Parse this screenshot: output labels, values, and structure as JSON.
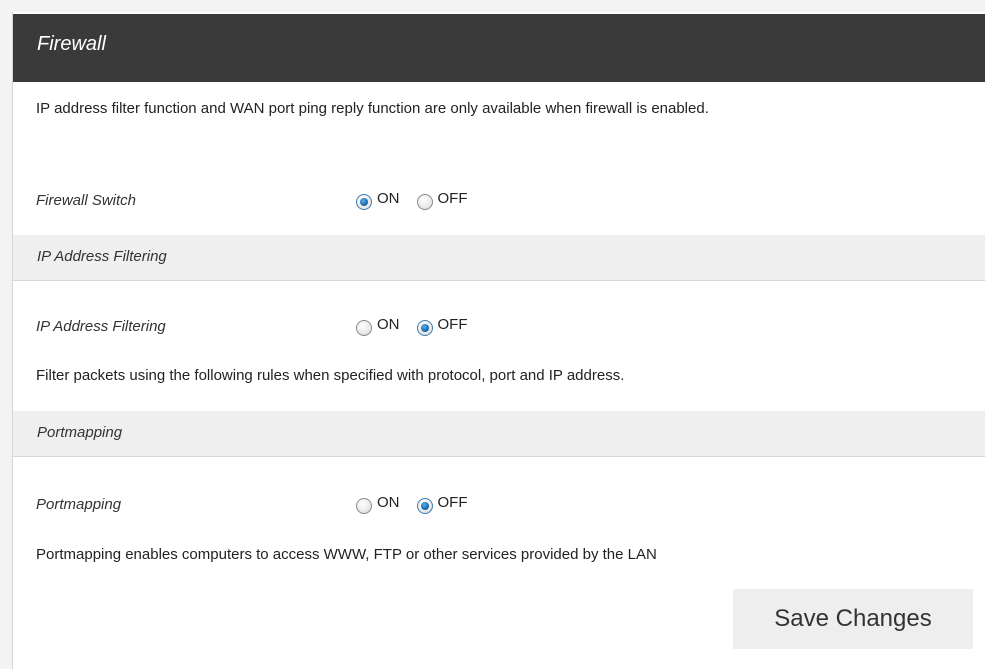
{
  "header": {
    "title": "Firewall"
  },
  "intro": {
    "text": "IP address filter function and WAN port ping reply function are only available when firewall is enabled."
  },
  "firewall_switch": {
    "label": "Firewall Switch",
    "on_label": "ON",
    "off_label": "OFF",
    "selected": "ON"
  },
  "ip_filtering_section": {
    "title": "IP Address Filtering",
    "label": "IP Address Filtering",
    "on_label": "ON",
    "off_label": "OFF",
    "selected": "OFF",
    "description": "Filter packets using the following rules when specified with protocol, port and IP address."
  },
  "portmapping_section": {
    "title": "Portmapping",
    "label": "Portmapping",
    "on_label": "ON",
    "off_label": "OFF",
    "selected": "OFF",
    "description": "Portmapping enables computers to access WWW, FTP or other services provided by the LAN"
  },
  "actions": {
    "save_label": "Save Changes"
  },
  "colors": {
    "header_bg": "#3a3a3a",
    "section_bg": "#efefef",
    "radio_selected": "#1a6fb3"
  }
}
